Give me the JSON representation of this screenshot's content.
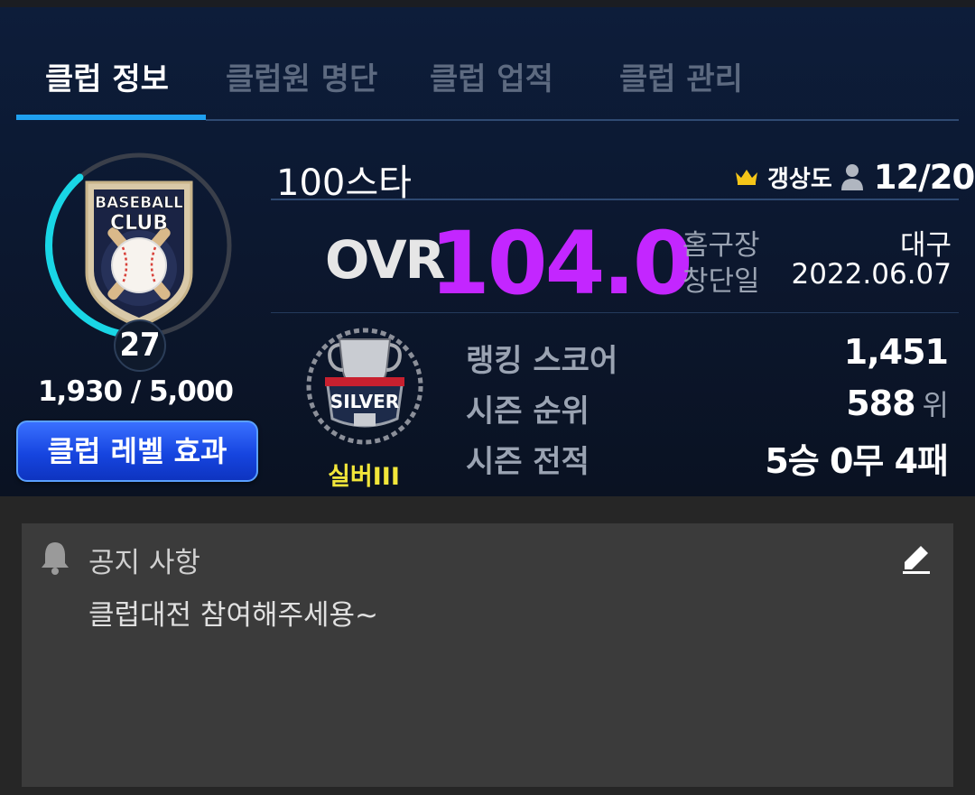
{
  "tabs": [
    {
      "label": "클럽 정보",
      "active": true
    },
    {
      "label": "클럽원 명단",
      "active": false
    },
    {
      "label": "클럽 업적",
      "active": false
    },
    {
      "label": "클럽 관리",
      "active": false
    }
  ],
  "club": {
    "emblem_text_1": "BASEBALL",
    "emblem_text_2": "CLUB",
    "level": "27",
    "exp_text": "1,930 / 5,000",
    "exp_fraction": 0.386,
    "level_button": "클럽 레벨 효과",
    "name": "100스타",
    "region": "갱상도",
    "members": "12/20",
    "ovr_label": "OVR",
    "ovr_value": "104.0",
    "home_label": "홈구장",
    "home_value": "대구",
    "founded_label": "창단일",
    "founded_value": "2022.06.07"
  },
  "tier": {
    "badge_text": "SILVER",
    "name": "실버III"
  },
  "stats": {
    "ranking_label": "랭킹 스코어",
    "ranking_value": "1,451",
    "season_rank_label": "시즌 순위",
    "season_rank_value": "588",
    "season_rank_unit": "위",
    "season_record_label": "시즌 전적",
    "season_record_value": "5승 0무 4패"
  },
  "notice": {
    "title": "공지 사항",
    "body": "클럽대전 참여해주세용~"
  },
  "colors": {
    "accent": "#1fa0f0",
    "ovr": "#c326ff",
    "tier_name": "#f2e63a",
    "level_ring": "#19d6e6"
  },
  "icons": [
    "crown-icon",
    "person-icon",
    "bell-icon",
    "edit-icon"
  ]
}
